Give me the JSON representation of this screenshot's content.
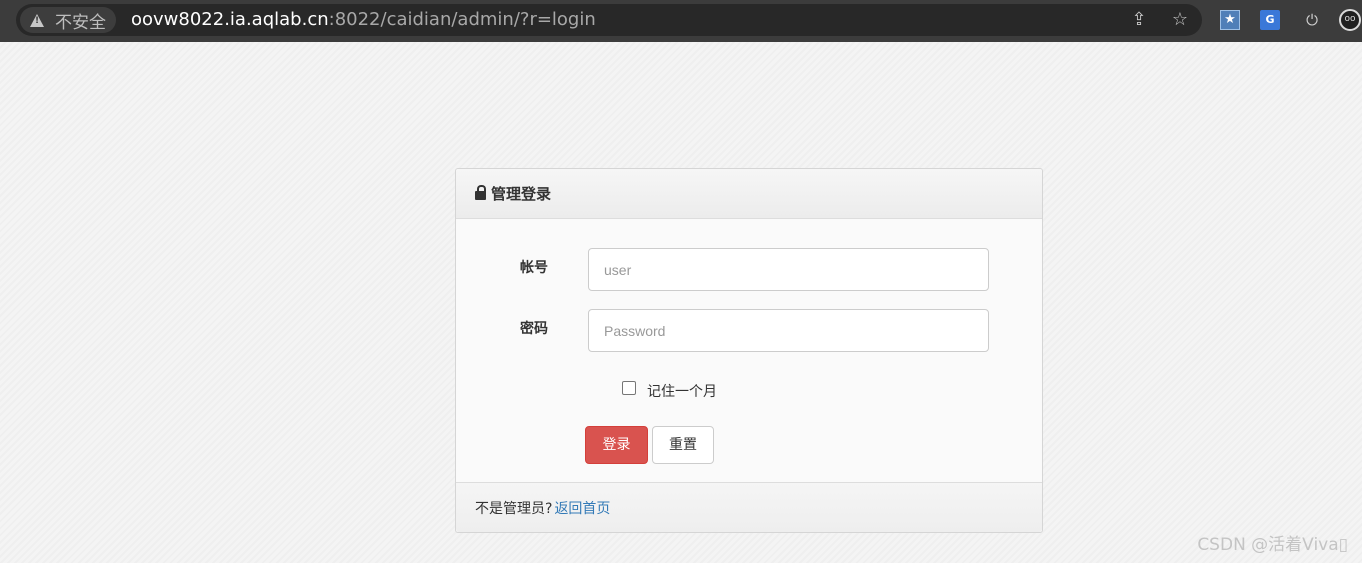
{
  "browser": {
    "security_label": "不安全",
    "url_host": "oovw8022.ia.aqlab.cn",
    "url_rest": ":8022/caidian/admin/?r=login"
  },
  "panel": {
    "title": "管理登录",
    "account_label": "帐号",
    "account_placeholder": "user",
    "password_label": "密码",
    "password_placeholder": "Password",
    "remember_label": "记住一个月",
    "login_button": "登录",
    "reset_button": "重置",
    "footer_text": "不是管理员?",
    "footer_link": "返回首页"
  },
  "watermark": "CSDN @活着Viva▯",
  "icons": [
    "warning-icon",
    "share-icon",
    "star-icon",
    "extension-icon",
    "translate-icon",
    "power-icon",
    "profile-icon",
    "lock-icon"
  ]
}
